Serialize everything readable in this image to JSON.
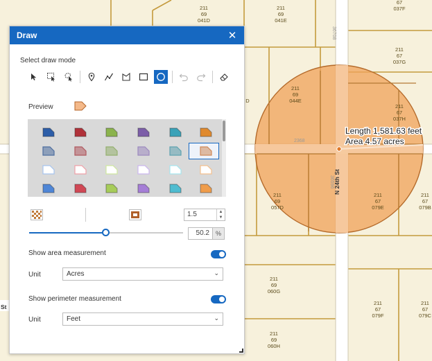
{
  "map": {
    "parcel_labels": [
      {
        "lines": [
          "211",
          "69",
          "041D"
        ]
      },
      {
        "lines": [
          "211",
          "69",
          "041E"
        ]
      },
      {
        "lines": [
          "67",
          "037F"
        ]
      },
      {
        "lines": [
          "211",
          "67",
          "037G"
        ]
      },
      {
        "lines": [
          "211",
          "69",
          "044E"
        ]
      },
      {
        "lines": [
          "D"
        ]
      },
      {
        "lines": [
          "211",
          "67",
          "037H"
        ]
      },
      {
        "lines": [
          "211",
          "69",
          "057D"
        ]
      },
      {
        "lines": [
          "211",
          "67",
          "079E"
        ]
      },
      {
        "lines": [
          "211",
          "67",
          "079B"
        ]
      },
      {
        "lines": [
          "211",
          "69",
          "060G"
        ]
      },
      {
        "lines": [
          "211",
          "67",
          "079F"
        ]
      },
      {
        "lines": [
          "211",
          "67",
          "079C"
        ]
      },
      {
        "lines": [
          "211",
          "69",
          "060H"
        ]
      }
    ],
    "street_labels": {
      "top_right_road": "36708",
      "road_segment": "2368",
      "vertical_road": "36596",
      "named_street": "N 24th St",
      "left_fragment": "St"
    },
    "measurement": {
      "length_text": "Length 1,581.63 feet",
      "area_text": "Area 4.57 acres"
    },
    "buffer_color": "#f0a15a"
  },
  "panel": {
    "title": "Draw",
    "close_glyph": "✕",
    "select_mode_label": "Select draw mode",
    "tools": [
      {
        "name": "select-tool",
        "icon": "pointer-icon"
      },
      {
        "name": "rect-select-tool",
        "icon": "rect-select-icon"
      },
      {
        "name": "lasso-select-tool",
        "icon": "lasso-icon"
      },
      {
        "name": "point-tool",
        "icon": "pin-icon"
      },
      {
        "name": "polyline-tool",
        "icon": "polyline-icon"
      },
      {
        "name": "polygon-tool",
        "icon": "polygon-icon"
      },
      {
        "name": "rectangle-tool",
        "icon": "rectangle-icon"
      },
      {
        "name": "circle-tool",
        "icon": "circle-icon",
        "active": true
      },
      {
        "name": "undo-button",
        "icon": "undo-icon",
        "disabled": true
      },
      {
        "name": "redo-button",
        "icon": "redo-icon",
        "disabled": true
      },
      {
        "name": "erase-button",
        "icon": "eraser-icon"
      }
    ],
    "preview_label": "Preview",
    "symbol_colors": [
      {
        "row": "solid-dark",
        "colors": [
          "#2d5ea8",
          "#b0323a",
          "#8bb34d",
          "#7c5ea8",
          "#3aa2b8",
          "#e08a2e"
        ]
      },
      {
        "row": "muted",
        "colors": [
          "#4f6fa0",
          "#b05a60",
          "#95b070",
          "#9d8abf",
          "#5fa3b0",
          "#d08a5a"
        ]
      },
      {
        "row": "outline",
        "colors": [
          "#a6c4ef",
          "#efa0a8",
          "#cfe8a0",
          "#cbb6ee",
          "#a6e6ef",
          "#f4c08e"
        ]
      },
      {
        "row": "bright",
        "colors": [
          "#4f86d6",
          "#d04855",
          "#a7cc5a",
          "#a57ed6",
          "#4fbcd0",
          "#ef9c4a"
        ]
      }
    ],
    "width_value": "1.5",
    "opacity_value": "50.2",
    "opacity_unit": "%",
    "opacity_fraction": 0.502,
    "show_area_label": "Show area measurement",
    "area_unit_label": "Unit",
    "area_unit_value": "Acres",
    "show_perimeter_label": "Show perimeter measurement",
    "perimeter_unit_label": "Unit",
    "perimeter_unit_value": "Feet"
  }
}
